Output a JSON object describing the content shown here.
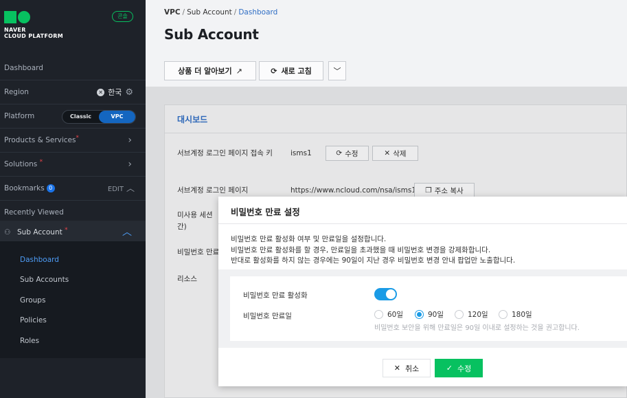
{
  "brand": {
    "line1": "NAVER",
    "line2": "CLOUD PLATFORM",
    "console_badge": "콘솔",
    "color": "#07c160"
  },
  "sidebar": {
    "dashboard": "Dashboard",
    "region_label": "Region",
    "region_value": "한국",
    "platform_label": "Platform",
    "platform_options": [
      "Classic",
      "VPC"
    ],
    "platform_selected": "VPC",
    "products_label": "Products & Services",
    "solutions_label": "Solutions",
    "required_mark": "*",
    "bookmarks_label": "Bookmarks",
    "bookmarks_count": "0",
    "bookmarks_edit": "EDIT",
    "recently_viewed": "Recently Viewed",
    "sub_account": "Sub Account",
    "sub_items": [
      "Dashboard",
      "Sub Accounts",
      "Groups",
      "Policies",
      "Roles"
    ],
    "active_sub_item": "Dashboard"
  },
  "breadcrumb": {
    "home": "VPC",
    "section": "Sub Account",
    "current": "Dashboard",
    "separator": "/"
  },
  "page": {
    "title": "Sub Account",
    "learn_more_button": "상품 더 알아보기",
    "refresh_button": "새로 고침"
  },
  "panel": {
    "title": "대시보드",
    "row1_label": "서브계정 로그인 페이지 접속 키",
    "row1_value": "isms1",
    "edit_button": "수정",
    "delete_button": "삭제",
    "row2_label": "서브계정 로그인 페이지",
    "row2_value": "https://www.ncloud.com/nsa/isms1",
    "copy_button": "주소 복사",
    "row3_label_a": "미사용 세션 ",
    "row3_label_b": "간)",
    "row4_label": "비밀번호 만료",
    "row5_label": "리소스"
  },
  "modal": {
    "title": "비밀번호 만료 설정",
    "desc": [
      "비밀번호 만료 활성화 여부 및 만료일을 설정합니다.",
      "비밀번호 만료 활성화를 할 경우, 만료일을 초과했을 때 비밀번호 변경을 강제화합니다.",
      "반대로 활성화를 하지 않는 경우에는 90일이 지난 경우 비밀번호 변경 안내 팝업만 노출합니다."
    ],
    "enable_label": "비밀번호 만료 활성화",
    "enable_on": true,
    "expiry_label": "비밀번호 만료일",
    "options": [
      "60일",
      "90일",
      "120일",
      "180일"
    ],
    "selected_option": "90일",
    "hint": "비밀번호 보안을 위해 만료일은 90일 이내로 설정하는 것을 권고합니다.",
    "cancel_button": "취소",
    "confirm_button": "수정",
    "accent": "#1a9be6"
  }
}
